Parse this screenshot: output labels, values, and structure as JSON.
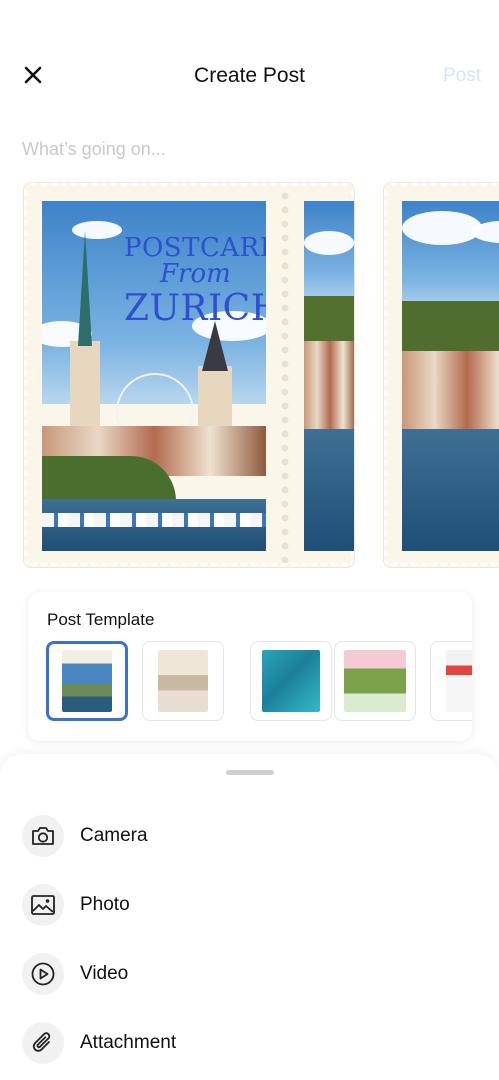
{
  "header": {
    "close_icon": "close-icon",
    "title": "Create Post",
    "post_label": "Post"
  },
  "composer": {
    "placeholder": "What’s going on..."
  },
  "carousel": {
    "postcard_line1": "POSTCARD",
    "postcard_line2": "From",
    "postcard_line3": "ZURICH"
  },
  "templates": {
    "title": "Post Template",
    "items": [
      {
        "name": "template-postcard-journal",
        "selected": true
      },
      {
        "name": "template-travel-journal",
        "selected": false
      },
      {
        "name": "template-travel-collage",
        "selected": false
      },
      {
        "name": "template-summer",
        "selected": false
      },
      {
        "name": "template-magazine",
        "selected": false
      }
    ]
  },
  "sheet": {
    "options": [
      {
        "label": "Camera",
        "icon": "camera-icon"
      },
      {
        "label": "Photo",
        "icon": "image-icon"
      },
      {
        "label": "Video",
        "icon": "play-circle-icon"
      },
      {
        "label": "Attachment",
        "icon": "paperclip-icon"
      }
    ]
  },
  "colors": {
    "accent": "#3b6fd4",
    "post_disabled": "#d4e6f6",
    "postcard_text": "#2e4fcf"
  }
}
